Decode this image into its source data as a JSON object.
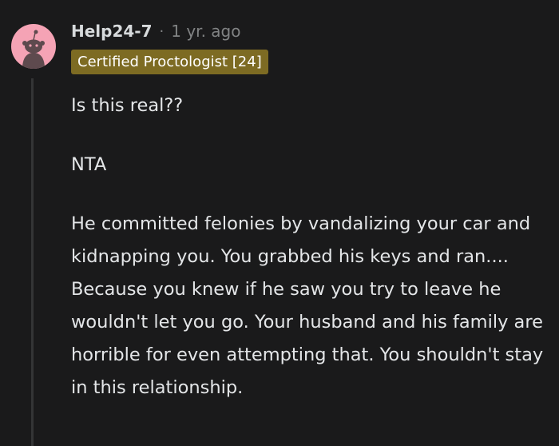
{
  "comment": {
    "author": "Help24-7",
    "separator": "·",
    "timestamp": "1 yr. ago",
    "flair": "Certified Proctologist [24]",
    "paragraphs": [
      "Is this real??",
      "NTA",
      "He committed felonies by vandalizing your car and kidnapping you. You grabbed his keys and ran.... Because you knew if he saw you try to leave he wouldn't let you go. Your husband and his family are horrible for even attempting that. You shouldn't stay in this relationship."
    ]
  },
  "icons": {
    "avatar": "snoo-avatar-icon"
  },
  "colors": {
    "background": "#1a1a1b",
    "avatar_bg": "#f5a3b5",
    "flair_bg": "#7d6b23",
    "muted_text": "#818384",
    "thread_line": "#343536"
  }
}
